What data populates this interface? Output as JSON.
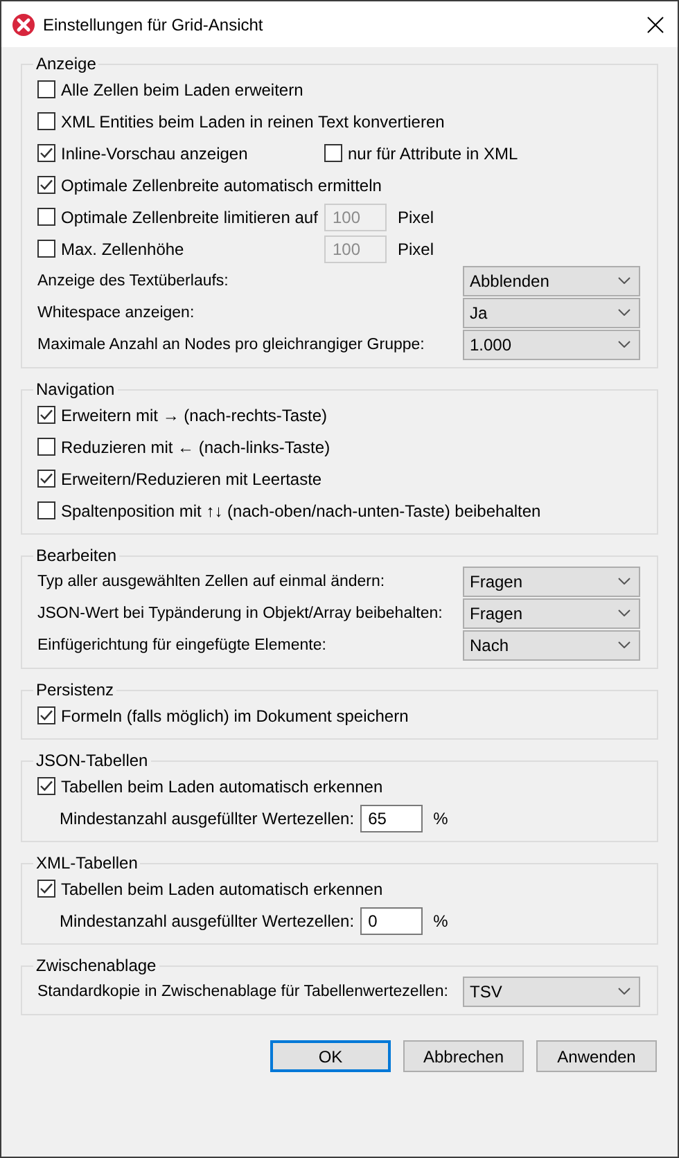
{
  "window": {
    "title": "Einstellungen für Grid-Ansicht"
  },
  "groups": [
    {
      "title": "Anzeige",
      "rows": [
        {
          "kind": "checkbox",
          "label": "Alle Zellen beim Laden erweitern",
          "checked": false
        },
        {
          "kind": "checkbox",
          "label": "XML Entities beim Laden in reinen Text konvertieren",
          "checked": false
        },
        {
          "kind": "checkbox_pair",
          "label": "Inline-Vorschau anzeigen",
          "checked": true,
          "second_label": "nur für Attribute in XML",
          "second_checked": false
        },
        {
          "kind": "checkbox",
          "label": "Optimale Zellenbreite automatisch ermitteln",
          "checked": true
        },
        {
          "kind": "checkbox_input",
          "label": "Optimale Zellenbreite limitieren auf",
          "checked": false,
          "value": "100",
          "disabled": true,
          "unit": "Pixel"
        },
        {
          "kind": "checkbox_input",
          "label": "Max. Zellenhöhe",
          "checked": false,
          "value": "100",
          "disabled": true,
          "unit": "Pixel"
        },
        {
          "kind": "select",
          "label": "Anzeige des Textüberlaufs:",
          "value": "Abblenden"
        },
        {
          "kind": "select",
          "label": "Whitespace anzeigen:",
          "value": "Ja"
        },
        {
          "kind": "select",
          "label": "Maximale Anzahl an Nodes pro gleichrangiger Gruppe:",
          "value": "1.000"
        }
      ]
    },
    {
      "title": "Navigation",
      "rows": [
        {
          "kind": "checkbox",
          "label": "Erweitern mit → (nach-rechts-Taste)",
          "checked": true
        },
        {
          "kind": "checkbox",
          "label": "Reduzieren mit ← (nach-links-Taste)",
          "checked": false
        },
        {
          "kind": "checkbox",
          "label": "Erweitern/Reduzieren mit Leertaste",
          "checked": true
        },
        {
          "kind": "checkbox",
          "label": "Spaltenposition mit ↑↓ (nach-oben/nach-unten-Taste) beibehalten",
          "checked": false
        }
      ]
    },
    {
      "title": "Bearbeiten",
      "rows": [
        {
          "kind": "select",
          "label": "Typ aller ausgewählten Zellen auf einmal ändern:",
          "value": "Fragen"
        },
        {
          "kind": "select",
          "label": "JSON-Wert bei Typänderung in Objekt/Array beibehalten:",
          "value": "Fragen"
        },
        {
          "kind": "select",
          "label": "Einfügerichtung für eingefügte Elemente:",
          "value": "Nach"
        }
      ]
    },
    {
      "title": "Persistenz",
      "rows": [
        {
          "kind": "checkbox",
          "label": "Formeln (falls möglich) im Dokument speichern",
          "checked": true
        }
      ]
    },
    {
      "title": "JSON-Tabellen",
      "rows": [
        {
          "kind": "checkbox",
          "label": "Tabellen beim Laden automatisch erkennen",
          "checked": true
        },
        {
          "kind": "input",
          "label": "Mindestanzahl ausgefüllter Wertezellen:",
          "value": "65",
          "disabled": false,
          "unit": "%"
        }
      ]
    },
    {
      "title": "XML-Tabellen",
      "rows": [
        {
          "kind": "checkbox",
          "label": "Tabellen beim Laden automatisch erkennen",
          "checked": true
        },
        {
          "kind": "input",
          "label": "Mindestanzahl ausgefüllter Wertezellen:",
          "value": "0",
          "disabled": false,
          "unit": "%"
        }
      ]
    },
    {
      "title": "Zwischenablage",
      "rows": [
        {
          "kind": "select",
          "label": "Standardkopie in Zwischenablage für Tabellenwertezellen:",
          "value": "TSV"
        }
      ]
    }
  ],
  "buttons": [
    {
      "label": "OK",
      "default": true
    },
    {
      "label": "Abbrechen",
      "default": false
    },
    {
      "label": "Anwenden",
      "default": false
    }
  ]
}
